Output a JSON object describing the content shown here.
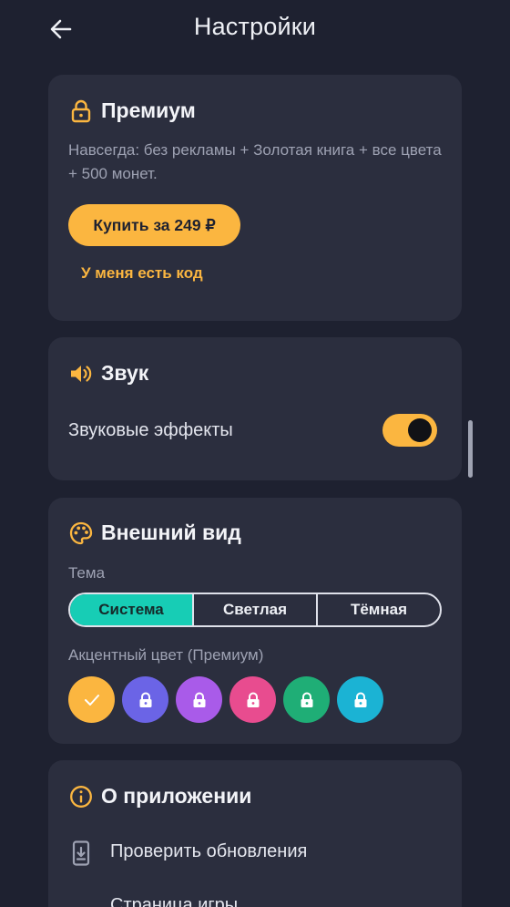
{
  "header": {
    "title": "Настройки",
    "back_icon": "arrow-left-icon"
  },
  "premium": {
    "icon": "lock-icon",
    "title": "Премиум",
    "description": "Навсегда: без рекламы + Золотая книга + все цвета + 500 монет.",
    "buy_label": "Купить за 249 ₽",
    "code_label": "У меня есть код"
  },
  "sound": {
    "icon": "speaker-icon",
    "title": "Звук",
    "effects_label": "Звуковые эффекты",
    "effects_enabled": true
  },
  "appearance": {
    "icon": "palette-icon",
    "title": "Внешний вид",
    "theme_label": "Тема",
    "themes": [
      {
        "label": "Система",
        "selected": true
      },
      {
        "label": "Светлая",
        "selected": false
      },
      {
        "label": "Тёмная",
        "selected": false
      }
    ],
    "accent_label": "Акцентный цвет (Премиум)",
    "accent_colors": [
      {
        "color": "#fbb640",
        "state": "selected",
        "icon": "check-icon"
      },
      {
        "color": "#6b64e6",
        "state": "locked",
        "icon": "lock-icon"
      },
      {
        "color": "#a95be9",
        "state": "locked",
        "icon": "lock-icon"
      },
      {
        "color": "#e84c8f",
        "state": "locked",
        "icon": "lock-icon"
      },
      {
        "color": "#1fae76",
        "state": "locked",
        "icon": "lock-icon"
      },
      {
        "color": "#1bb3d4",
        "state": "locked",
        "icon": "lock-icon"
      }
    ]
  },
  "about": {
    "icon": "info-icon",
    "title": "О приложении",
    "items": [
      {
        "label": "Проверить обновления",
        "icon": "phone-download-icon"
      },
      {
        "label": "Страница игры",
        "icon": "link-icon"
      }
    ]
  },
  "colors": {
    "background": "#1e2130",
    "card": "#2b2e3e",
    "accent": "#fbb640",
    "theme_active": "#17cdb5"
  }
}
